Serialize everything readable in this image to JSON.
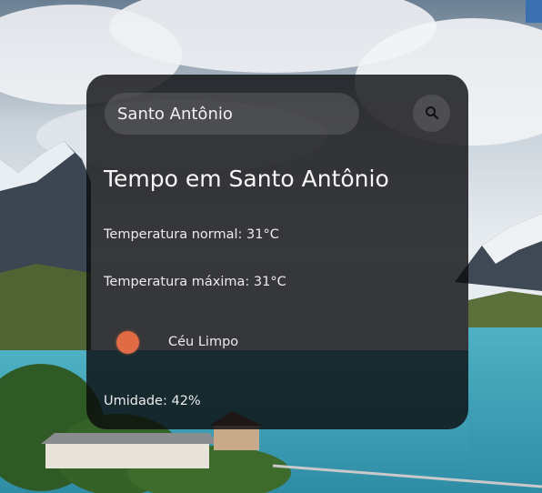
{
  "search": {
    "value": "Santo Antônio",
    "button_icon": "search-icon"
  },
  "weather": {
    "title": "Tempo em Santo Antônio",
    "temp_normal": "Temperatura normal: 31°C",
    "temp_max": "Temperatura máxima: 31°C",
    "icon": "clear-sky-sun-icon",
    "condition": "Céu Limpo",
    "humidity": "Umidade: 42%"
  },
  "colors": {
    "card_background": "#0a0a0c",
    "sun_icon": "#e06b45",
    "text": "#f2f2f2"
  }
}
